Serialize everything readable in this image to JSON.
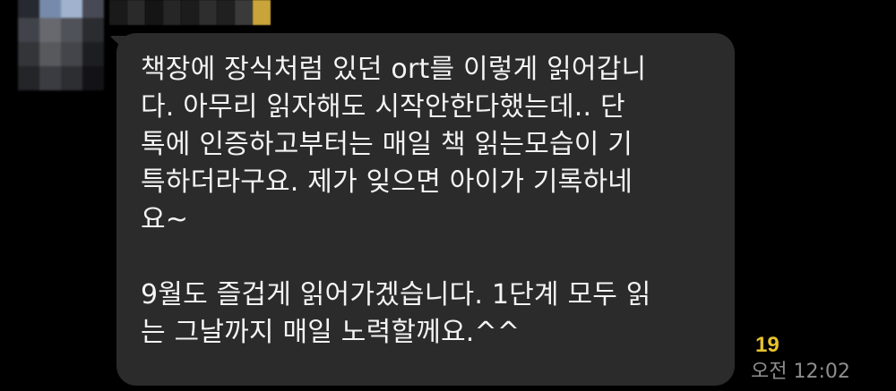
{
  "chat": {
    "sender_avatar_icon": "avatar-blurred",
    "message": {
      "text": "책장에 장식처럼 있던 ort를 이렇게 읽어갑니\n다. 아무리 읽자해도 시작안한다했는데.. 단\n톡에 인증하고부터는 매일 책 읽는모습이 기\n특하더라구요. 제가 잊으면 아이가 기록하네\n요~\n\n9월도 즐겁게 읽어가겠습니다. 1단계 모두 읽\n는 그날까지 매일 노력할께요.^^",
      "unread_count": "19",
      "timestamp": "오전 12:02"
    },
    "colors": {
      "background": "#000000",
      "bubble": "#2b2b2b",
      "text": "#f4f4f4",
      "unread": "#e7c32e",
      "timestamp": "#8e8e8e"
    }
  }
}
